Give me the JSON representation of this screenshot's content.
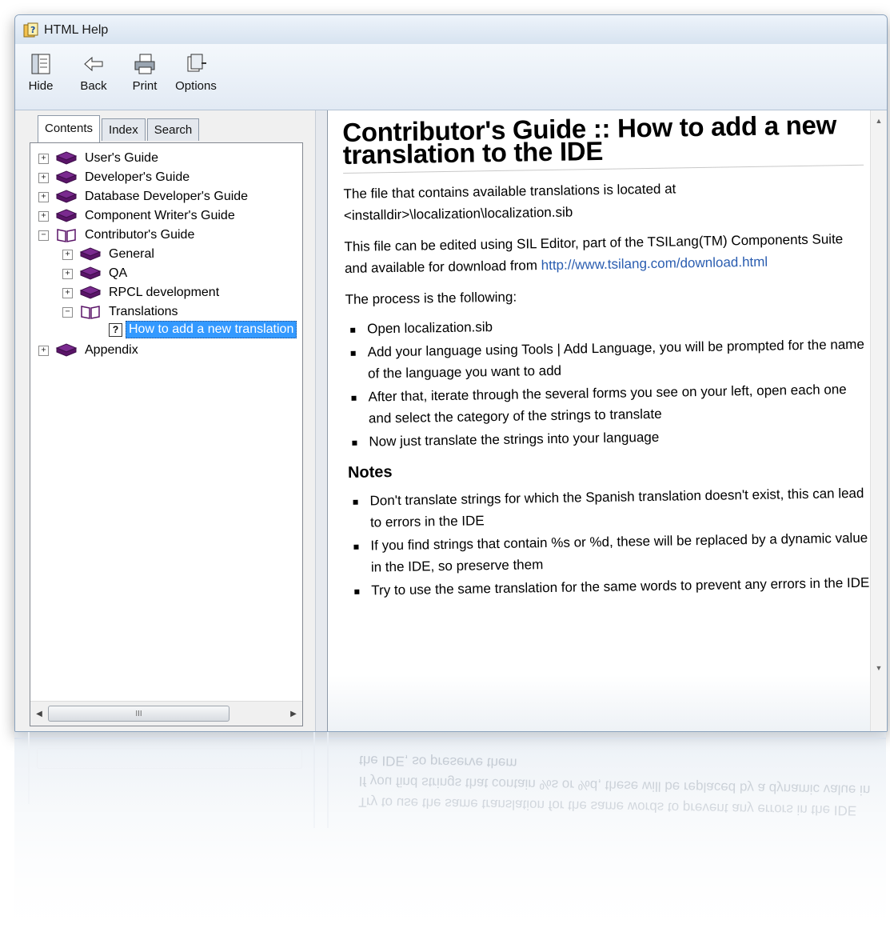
{
  "window": {
    "title": "HTML Help",
    "controls": {
      "minimize": "–",
      "maximize": "▫",
      "close": "✕"
    }
  },
  "toolbar": {
    "hide": "Hide",
    "back": "Back",
    "print": "Print",
    "options": "Options"
  },
  "nav_tabs": [
    "Contents",
    "Index",
    "Search"
  ],
  "tree": {
    "items": [
      {
        "label": "User's Guide",
        "state": "+"
      },
      {
        "label": "Developer's Guide",
        "state": "+"
      },
      {
        "label": "Database Developer's Guide",
        "state": "+"
      },
      {
        "label": "Component Writer's Guide",
        "state": "+"
      },
      {
        "label": "Contributor's Guide",
        "state": "−"
      },
      {
        "label": "General",
        "state": "+"
      },
      {
        "label": "QA",
        "state": "+"
      },
      {
        "label": "RPCL development",
        "state": "+"
      },
      {
        "label": "Translations",
        "state": "−"
      },
      {
        "label": "How to add a new translation"
      },
      {
        "label": "Appendix",
        "state": "+"
      }
    ],
    "hscroll_grip": "III"
  },
  "content": {
    "title": "Contributor's Guide :: How to add a new translation to the IDE",
    "p1": "The file that contains available translations is located at <installdir>\\localization\\localization.sib",
    "p2_prefix": "This file can be edited using SIL Editor, part of the TSILang(TM) Components Suite and available for download from ",
    "p2_link": "http://www.tsilang.com/download.html",
    "p3": "The process is the following:",
    "steps": [
      "Open localization.sib",
      "Add your language using Tools | Add Language, you will be prompted for the name of the language you want to add",
      "After that, iterate through the several forms you see on your left, open each one and select the category of the strings to translate",
      "Now just translate the strings into your language"
    ],
    "notes_heading": "Notes",
    "notes": [
      "Don't translate strings for which the Spanish translation doesn't exist, this can lead to errors in the IDE",
      "If you find strings that contain %s or %d, these will be replaced by a dynamic value in the IDE, so preserve them",
      "Try to use the same translation for the same words to prevent any errors in the IDE"
    ]
  },
  "colors": {
    "selection": "#3399ff",
    "book": "#6a1b7d",
    "link": "#2a5db0"
  }
}
